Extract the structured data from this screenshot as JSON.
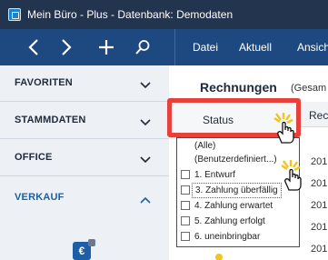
{
  "window": {
    "title": "Mein Büro - Plus - Datenbank: Demodaten"
  },
  "toolbar": {
    "icons": [
      "chevron-left-icon",
      "chevron-right-icon",
      "plus-icon",
      "search-icon"
    ],
    "menu": [
      "Datei",
      "Aktuell",
      "Ansich"
    ]
  },
  "sidebar": {
    "items": [
      {
        "label": "FAVORITEN",
        "expanded": false
      },
      {
        "label": "STAMMDATEN",
        "expanded": false
      },
      {
        "label": "OFFICE",
        "expanded": false
      },
      {
        "label": "VERKAUF",
        "expanded": true
      }
    ],
    "euro_symbol": "€"
  },
  "main": {
    "title": "Rechnungen",
    "subtitle": "(Gesam",
    "column_next": "Rec",
    "year_cells": [
      "201",
      "201",
      "201",
      "201",
      "201",
      "201"
    ]
  },
  "status_filter": {
    "header_label": "Status",
    "options": [
      {
        "label": "(Alle)",
        "has_checkbox": false
      },
      {
        "label": "(Benutzerdefiniert...)",
        "has_checkbox": false
      },
      {
        "label": "1. Entwurf",
        "has_checkbox": true,
        "checked": false
      },
      {
        "label": "3. Zahlung überfällig",
        "has_checkbox": true,
        "checked": false,
        "focused": true
      },
      {
        "label": "4. Zahlung erwartet",
        "has_checkbox": true,
        "checked": false
      },
      {
        "label": "5. Zahlung erfolgt",
        "has_checkbox": true,
        "checked": false
      },
      {
        "label": "6. uneinbringbar",
        "has_checkbox": true,
        "checked": false
      }
    ]
  },
  "colors": {
    "titlebar": "#23344f",
    "toolbar": "#1e4980",
    "highlight_border": "#e8403a",
    "sidebar_active": "#1d5fa6"
  }
}
